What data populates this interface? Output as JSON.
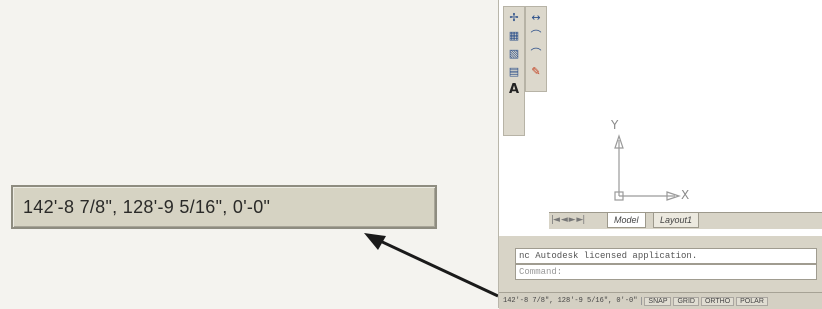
{
  "callout": {
    "coordinates": "142'-8 7/8\",  128'-9 5/16\", 0'-0\""
  },
  "toolbar": {
    "left_icons": [
      "crosshair-icon",
      "grid-icon",
      "block-icon",
      "table-icon",
      "text-icon"
    ],
    "right_icons": [
      "arrows-icon",
      "arc-icon",
      "arc-icon",
      "edit-icon"
    ],
    "text_tool_label": "A"
  },
  "ucs": {
    "y_label": "Y",
    "x_label": "X"
  },
  "tabs": {
    "nav": "|◄ ◄ ► ►|",
    "model": "Model",
    "layout1": "Layout1"
  },
  "command": {
    "history_line": "nc Autodesk licensed application.",
    "prompt": "Command:"
  },
  "status": {
    "coordinates": "142'-8 7/8\",  128'-9 5/16\", 0'-0\"",
    "buttons": [
      "SNAP",
      "GRID",
      "ORTHO",
      "POLAR"
    ]
  },
  "colors": {
    "callout_bg": "#d6d3c3",
    "arrow": "#1a1a1a"
  }
}
